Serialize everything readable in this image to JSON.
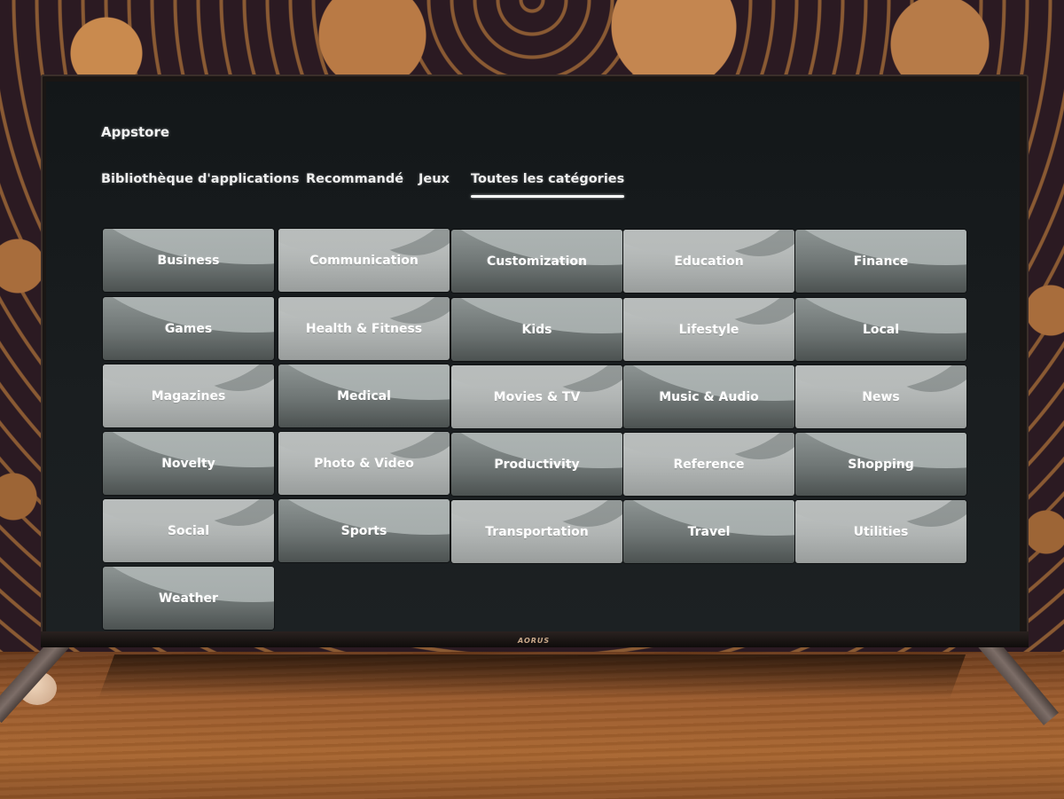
{
  "app": {
    "title": "Appstore"
  },
  "tabs": [
    {
      "label": "Bibliothèque d'applications",
      "active": false
    },
    {
      "label": "Recommandé",
      "active": false
    },
    {
      "label": "Jeux",
      "active": false
    },
    {
      "label": "Toutes les catégories",
      "active": true
    }
  ],
  "categories": [
    {
      "label": "Business",
      "style": "a"
    },
    {
      "label": "Communication",
      "style": "b"
    },
    {
      "label": "Customization",
      "style": "a"
    },
    {
      "label": "Education",
      "style": "b"
    },
    {
      "label": "Finance",
      "style": "a"
    },
    {
      "label": "Games",
      "style": "a"
    },
    {
      "label": "Health & Fitness",
      "style": "b"
    },
    {
      "label": "Kids",
      "style": "a"
    },
    {
      "label": "Lifestyle",
      "style": "b"
    },
    {
      "label": "Local",
      "style": "a"
    },
    {
      "label": "Magazines",
      "style": "b"
    },
    {
      "label": "Medical",
      "style": "a"
    },
    {
      "label": "Movies & TV",
      "style": "b"
    },
    {
      "label": "Music & Audio",
      "style": "a"
    },
    {
      "label": "News",
      "style": "b"
    },
    {
      "label": "Novelty",
      "style": "a"
    },
    {
      "label": "Photo & Video",
      "style": "b"
    },
    {
      "label": "Productivity",
      "style": "a"
    },
    {
      "label": "Reference",
      "style": "b"
    },
    {
      "label": "Shopping",
      "style": "a"
    },
    {
      "label": "Social",
      "style": "b"
    },
    {
      "label": "Sports",
      "style": "a"
    },
    {
      "label": "Transportation",
      "style": "b"
    },
    {
      "label": "Travel",
      "style": "a"
    },
    {
      "label": "Utilities",
      "style": "b"
    },
    {
      "label": "Weather",
      "style": "a"
    }
  ],
  "device": {
    "brand_logo": "AORUS"
  }
}
